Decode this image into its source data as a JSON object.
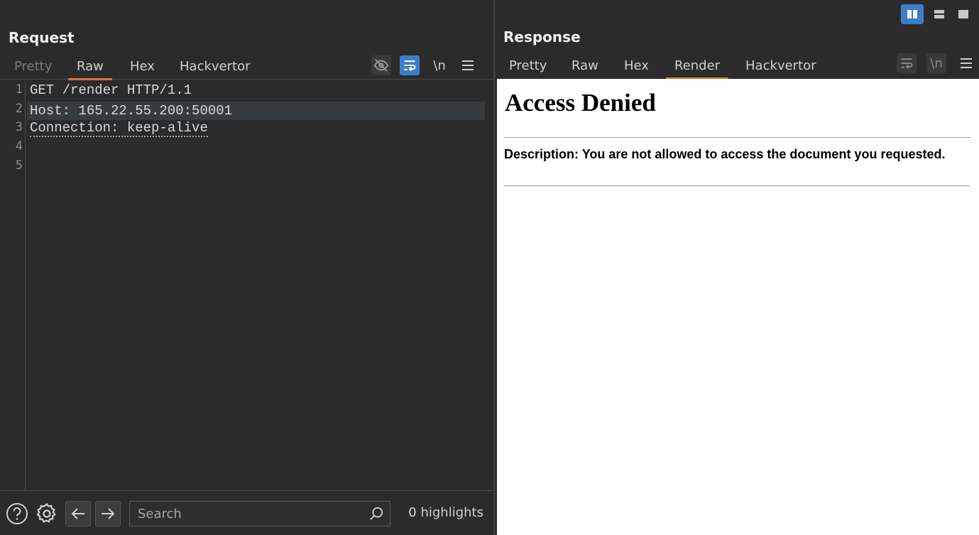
{
  "request": {
    "title": "Request",
    "tabs": [
      {
        "label": "Pretty",
        "state": "dim"
      },
      {
        "label": "Raw",
        "state": "active"
      },
      {
        "label": "Hex",
        "state": "normal"
      },
      {
        "label": "Hackvertor",
        "state": "normal"
      }
    ],
    "tools": {
      "newline_label": "\\n",
      "hide_icon": "eye-off-icon",
      "wrap_icon": "wrap-icon",
      "menu_icon": "hamburger-icon"
    },
    "line_numbers": [
      "1",
      "2",
      "3",
      "4",
      "5"
    ],
    "lines": [
      "GET /render HTTP/1.1",
      "Host: 165.22.55.200:50001",
      "Connection: keep-alive",
      "",
      ""
    ]
  },
  "footer": {
    "search_placeholder": "Search",
    "highlights": "0 highlights",
    "icons": [
      "help-icon",
      "gear-icon",
      "arrow-left-icon",
      "arrow-right-icon",
      "search-icon"
    ]
  },
  "response": {
    "title": "Response",
    "tabs": [
      {
        "label": "Pretty",
        "state": "normal"
      },
      {
        "label": "Raw",
        "state": "normal"
      },
      {
        "label": "Hex",
        "state": "normal"
      },
      {
        "label": "Render",
        "state": "active"
      },
      {
        "label": "Hackvertor",
        "state": "normal"
      }
    ],
    "tools": {
      "newline_label": "\\n"
    },
    "render": {
      "heading": "Access Denied",
      "description": "Description: You are not allowed to access the document you requested."
    }
  },
  "colors": {
    "accent": "#3d7ecb",
    "tab_underline": "#e2703a",
    "background": "#2b2b2b"
  }
}
